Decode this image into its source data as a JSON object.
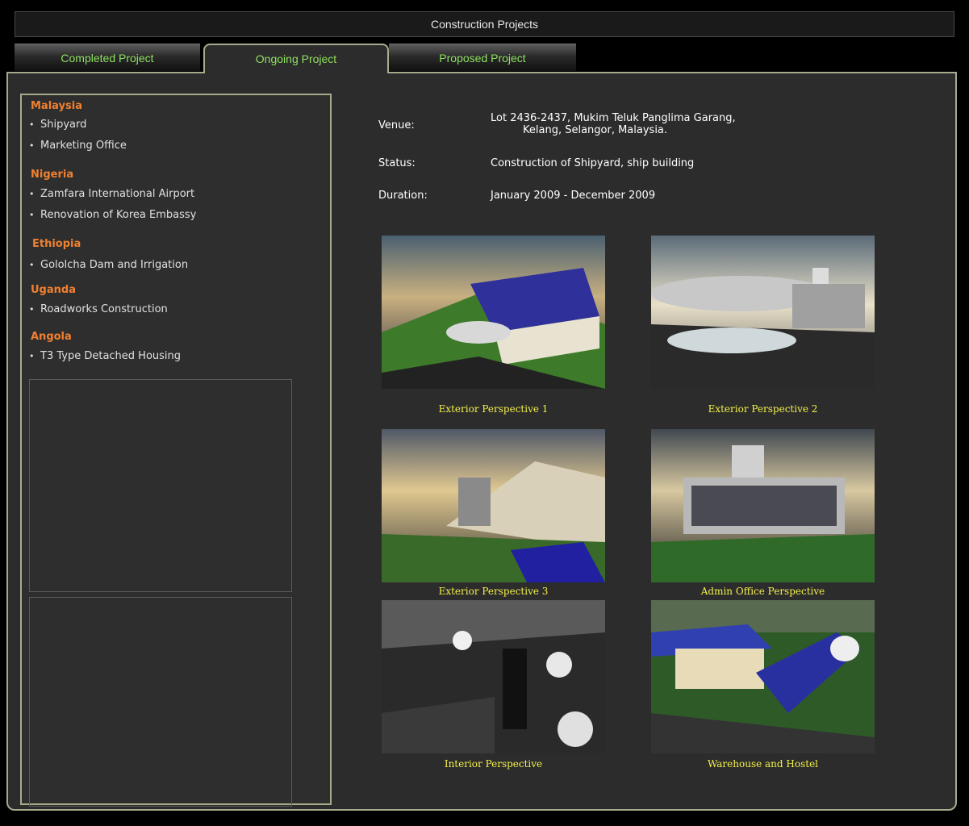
{
  "header": {
    "title": "Construction Projects"
  },
  "tabs": [
    {
      "label": "Completed Project"
    },
    {
      "label": "Ongoing Project"
    },
    {
      "label": "Proposed Project"
    }
  ],
  "sidebar": {
    "groups": [
      {
        "country": "Malaysia",
        "projects": [
          "Shipyard",
          "Marketing Office"
        ]
      },
      {
        "country": "Nigeria",
        "projects": [
          "Zamfara International Airport",
          "Renovation of Korea Embassy"
        ]
      },
      {
        "country": "Ethiopia",
        "projects": [
          "Gololcha Dam and Irrigation"
        ]
      },
      {
        "country": "Uganda",
        "projects": [
          "Roadworks Construction"
        ]
      },
      {
        "country": "Angola",
        "projects": [
          "T3 Type Detached Housing"
        ]
      }
    ]
  },
  "details": {
    "venue_label": "Venue:",
    "venue_line1": "Lot 2436-2437, Mukim Teluk Panglima Garang,",
    "venue_line2": "Kelang, Selangor, Malaysia.",
    "status_label": "Status:",
    "status_value": "Construction of Shipyard, ship building",
    "duration_label": "Duration:",
    "duration_value": "January 2009 - December 2009"
  },
  "gallery": [
    {
      "caption": "Exterior Perspective 1"
    },
    {
      "caption": "Exterior Perspective 2"
    },
    {
      "caption": "Exterior Perspective 3"
    },
    {
      "caption": "Admin Office Perspective"
    },
    {
      "caption": "Interior Perspective"
    },
    {
      "caption": "Warehouse and Hostel"
    }
  ],
  "colors": {
    "tab_text": "#8ee060",
    "country": "#f08030",
    "caption": "#f4f04a",
    "border": "#a8aa8c"
  }
}
